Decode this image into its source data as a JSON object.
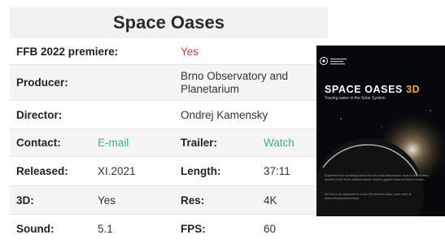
{
  "card": {
    "title": "Space Oases",
    "rows": {
      "premiere": {
        "label": "FFB 2022 premiere:",
        "value": "Yes",
        "value_color": "#e53935"
      },
      "producer": {
        "label": "Producer:",
        "value": "Brno Observatory and Planetarium"
      },
      "director": {
        "label": "Director:",
        "value": "Ondrej Kamensky"
      },
      "contact": {
        "label": "Contact:",
        "value": "E-mail",
        "trailer_label": "Trailer:",
        "trailer_value": "Watch",
        "link_color": "#34b68a"
      },
      "released": {
        "label": "Released:",
        "value": "XI.2021",
        "length_label": "Length:",
        "length_value": "37:11"
      },
      "threed": {
        "label": "3D:",
        "value": "Yes",
        "res_label": "Res:",
        "res_value": "4K"
      },
      "sound": {
        "label": "Sound:",
        "value": "5.1",
        "fps_label": "FPS:",
        "fps_value": "60"
      }
    }
  },
  "poster": {
    "title_main": "SPACE OASES",
    "title_accent": "3D",
    "subtitle": "Tracing water in the Solar System",
    "text1": "Experience the scorching heat of the thin solar atmosphere. Soar on the endless deserts of the frozen Martian worlds. Explore gigantic flows on frozen moons.",
    "text2": "Set out on an adventure in a new 3D fulldome show. Learn more at www.brnoplanetarium.com"
  }
}
